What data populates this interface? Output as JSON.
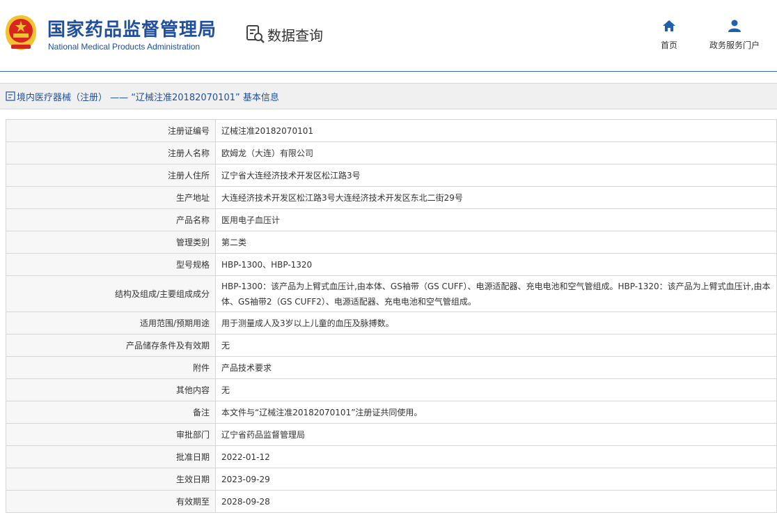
{
  "header": {
    "title": "国家药品监督管理局",
    "subtitle": "National Medical Products Administration",
    "query_label": "数据查询",
    "nav": {
      "home": "首页",
      "service": "政务服务门户"
    }
  },
  "breadcrumb": {
    "text": "境内医疗器械（注册） —— “辽械注准20182070101” 基本信息"
  },
  "rows": [
    {
      "label": "注册证编号",
      "value": "辽械注准20182070101"
    },
    {
      "label": "注册人名称",
      "value": "欧姆龙（大连）有限公司"
    },
    {
      "label": "注册人住所",
      "value": "辽宁省大连经济技术开发区松江路3号"
    },
    {
      "label": "生产地址",
      "value": "大连经济技术开发区松江路3号大连经济技术开发区东北二街29号"
    },
    {
      "label": "产品名称",
      "value": "医用电子血压计"
    },
    {
      "label": "管理类别",
      "value": "第二类"
    },
    {
      "label": "型号规格",
      "value": "HBP-1300、HBP-1320"
    },
    {
      "label": "结构及组成/主要组成成分",
      "value": "HBP-1300：该产品为上臂式血压计,由本体、GS袖带（GS CUFF）、电源适配器、充电电池和空气管组成。HBP-1320：该产品为上臂式血压计,由本体、GS袖带2（GS CUFF2）、电源适配器、充电电池和空气管组成。"
    },
    {
      "label": "适用范围/预期用途",
      "value": "用于测量成人及3岁以上儿童的血压及脉搏数。"
    },
    {
      "label": "产品储存条件及有效期",
      "value": "无"
    },
    {
      "label": "附件",
      "value": "产品技术要求"
    },
    {
      "label": "其他内容",
      "value": "无"
    },
    {
      "label": "备注",
      "value": "本文件与“辽械注准20182070101”注册证共同使用。"
    },
    {
      "label": "审批部门",
      "value": "辽宁省药品监督管理局"
    },
    {
      "label": "批准日期",
      "value": "2022-01-12"
    },
    {
      "label": "生效日期",
      "value": "2023-09-29"
    },
    {
      "label": "有效期至",
      "value": "2028-09-28"
    }
  ],
  "colors": {
    "brand": "#1f4f9e",
    "emblem_red": "#d7261f",
    "emblem_gold": "#f2c233"
  },
  "icons": [
    "emblem-icon",
    "data-query-icon",
    "home-icon",
    "user-icon",
    "document-icon"
  ]
}
